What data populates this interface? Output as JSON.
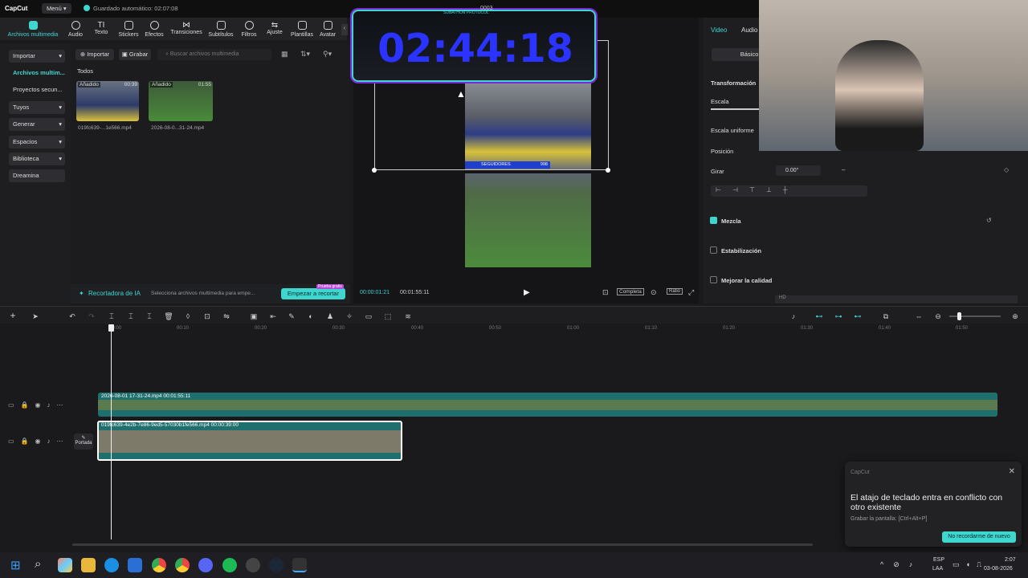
{
  "app": {
    "logo": "CapCut",
    "menu": "Menú",
    "autosave": "Guardado automático: 02:07:08",
    "project_title": "0003"
  },
  "toolbar": [
    "Archivos multimedia",
    "Audio",
    "Texto",
    "Stickers",
    "Efectos",
    "Transiciones",
    "Subtítulos",
    "Filtros",
    "Ajuste",
    "Plantillas",
    "Avatar"
  ],
  "sidebar": [
    "Importar",
    "Archivos multim...",
    "Proyectos secun...",
    "Tuyos",
    "Generar",
    "Espacios",
    "Biblioteca",
    "Dreamina"
  ],
  "media": {
    "import": "Importar",
    "record": "Grabar",
    "search_placeholder": "Buscar archivos multimedia",
    "all": "Todos",
    "items": [
      {
        "badge": "Añadido",
        "duration": "00:39",
        "name": "019fc639-...1e566.mp4"
      },
      {
        "badge": "Añadido",
        "duration": "01:55",
        "name": "2026-08-0...31-24.mp4"
      }
    ]
  },
  "ai_bar": {
    "title": "Recortadora de IA",
    "hint": "Selecciona archivos multimedia para empe...",
    "cta": "Empezar a recortar",
    "badge": "Prueba gratis"
  },
  "player": {
    "timer": "02:44:18",
    "timer_label": "SUBATHON PROTOCOL",
    "followers_label": "SEGUIDORES",
    "followers_count": "998",
    "current": "00:00:01:21",
    "total": "00:01:55:11",
    "full_btn": "Completa",
    "ratio": "Ratio"
  },
  "right": {
    "tabs": [
      "Video",
      "Audio"
    ],
    "subtab": "Básico",
    "transform": "Transformación",
    "scale": "Escala",
    "uniform": "Escala uniforme",
    "position": "Posición",
    "rotate": "Girar",
    "rotate_val": "0.00°",
    "blend": "Mezcla",
    "stabilize": "Estabilización",
    "enhance": "Mejorar la calidad",
    "hd": "HD"
  },
  "timeline": {
    "ticks": [
      "00:00",
      "00:10",
      "00:20",
      "00:30",
      "00:40",
      "00:50",
      "01:00",
      "01:10",
      "01:20",
      "01:30",
      "01:40",
      "01:50"
    ],
    "clip1_name": "2026-08-01 17-31-24.mp4",
    "clip1_dur": "00:01:55:11",
    "clip2_name": "019fc639-4e2b-7e86-9ed5-57030b1fe566.mp4",
    "clip2_dur": "00:00:39:00",
    "cover": "Portada"
  },
  "toast": {
    "app": "CapCut",
    "title": "El atajo de teclado entra en conflicto con otro existente",
    "sub": "Grabar la pantalla: [Ctrl+Alt+P]",
    "btn": "No recordarme de nuevo"
  },
  "taskbar": {
    "lang1": "ESP",
    "lang2": "LAA",
    "time": "2:07",
    "date": "03-08-2026"
  },
  "colors": {
    "accent": "#3fd6cf",
    "timer": "#2a33ff",
    "clip": "#1f6f6e"
  }
}
